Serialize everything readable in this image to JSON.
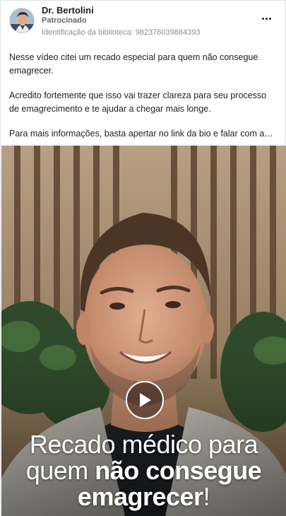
{
  "ad": {
    "advertiser_name": "Dr. Bertolini",
    "sponsored_label": "Patrocinado",
    "library_id": "Identificação da biblioteca: 982376039884393",
    "more_icon": "more-horizontal-icon",
    "body": {
      "paragraph_1": "Nesse vídeo citei um recado especial para quem não consegue emagrecer.",
      "paragraph_2": "Acredito fortemente que isso vai trazer clareza para seu processo de emagrecimento e te ajudar a chegar mais longe.",
      "paragraph_3": "Para mais informações, basta apertar no link da bio e falar com a…"
    },
    "video": {
      "play_icon": "play-icon",
      "overlay": {
        "line_1": "Recado médico para",
        "line_2_regular": "quem ",
        "line_2_bold": "não consegue",
        "line_3_bold": "emagrecer",
        "line_3_regular": "!"
      }
    }
  },
  "colors": {
    "text_primary": "#1c1e21",
    "text_secondary": "#65676b",
    "text_muted": "#8a8d91",
    "overlay_text": "#ffffff"
  }
}
